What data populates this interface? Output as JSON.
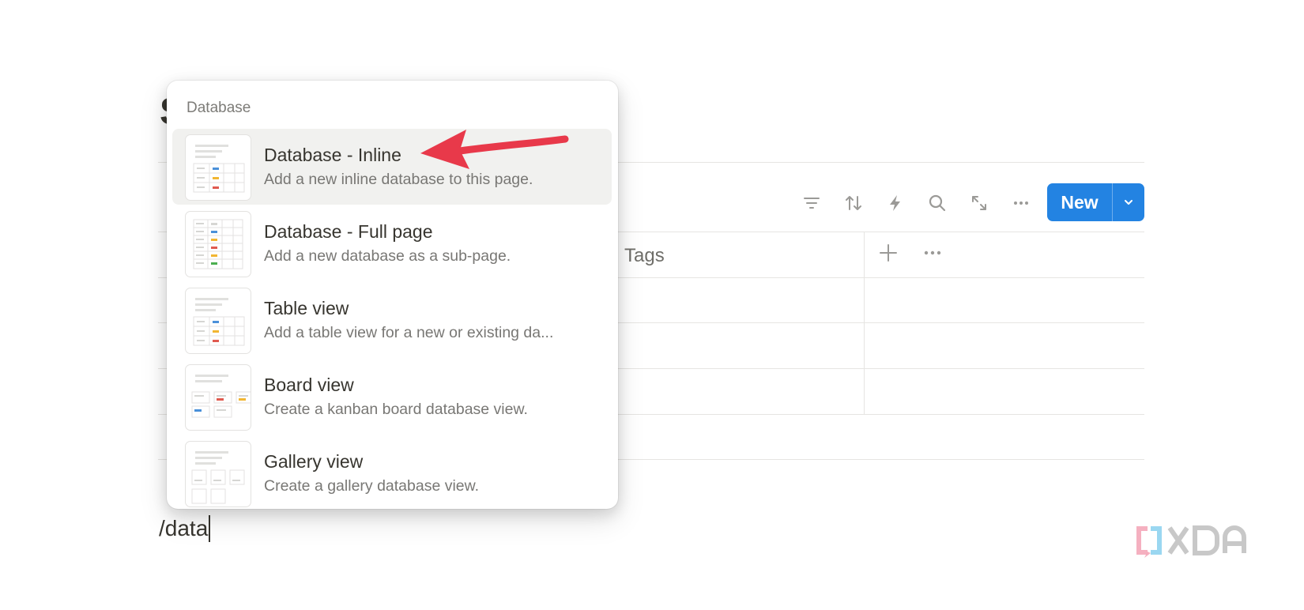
{
  "page": {
    "title_partial": "S",
    "slash_command_text": "/data"
  },
  "toolbar": {
    "icons": [
      "filter-icon",
      "sort-icon",
      "automation-icon",
      "search-icon",
      "expand-icon",
      "more-icon"
    ],
    "new_button_label": "New"
  },
  "table": {
    "columns": [
      {
        "label": "Tags"
      }
    ]
  },
  "menu": {
    "section_label": "Database",
    "items": [
      {
        "title": "Database - Inline",
        "description": "Add a new inline database to this page.",
        "active": true,
        "thumb": "inline"
      },
      {
        "title": "Database - Full page",
        "description": "Add a new database as a sub-page.",
        "active": false,
        "thumb": "full"
      },
      {
        "title": "Table view",
        "description": "Add a table view for a new or existing da...",
        "active": false,
        "thumb": "table"
      },
      {
        "title": "Board view",
        "description": "Create a kanban board database view.",
        "active": false,
        "thumb": "board"
      },
      {
        "title": "Gallery view",
        "description": "Create a gallery database view.",
        "active": false,
        "thumb": "gallery"
      }
    ]
  },
  "watermark": {
    "text": "XDA"
  },
  "colors": {
    "accent": "#2383e2",
    "annotation_arrow": "#e8394a",
    "thumb_blue": "#4a90d9",
    "thumb_yellow": "#f2b632",
    "thumb_red": "#e05a4f",
    "thumb_green": "#4caf50"
  }
}
